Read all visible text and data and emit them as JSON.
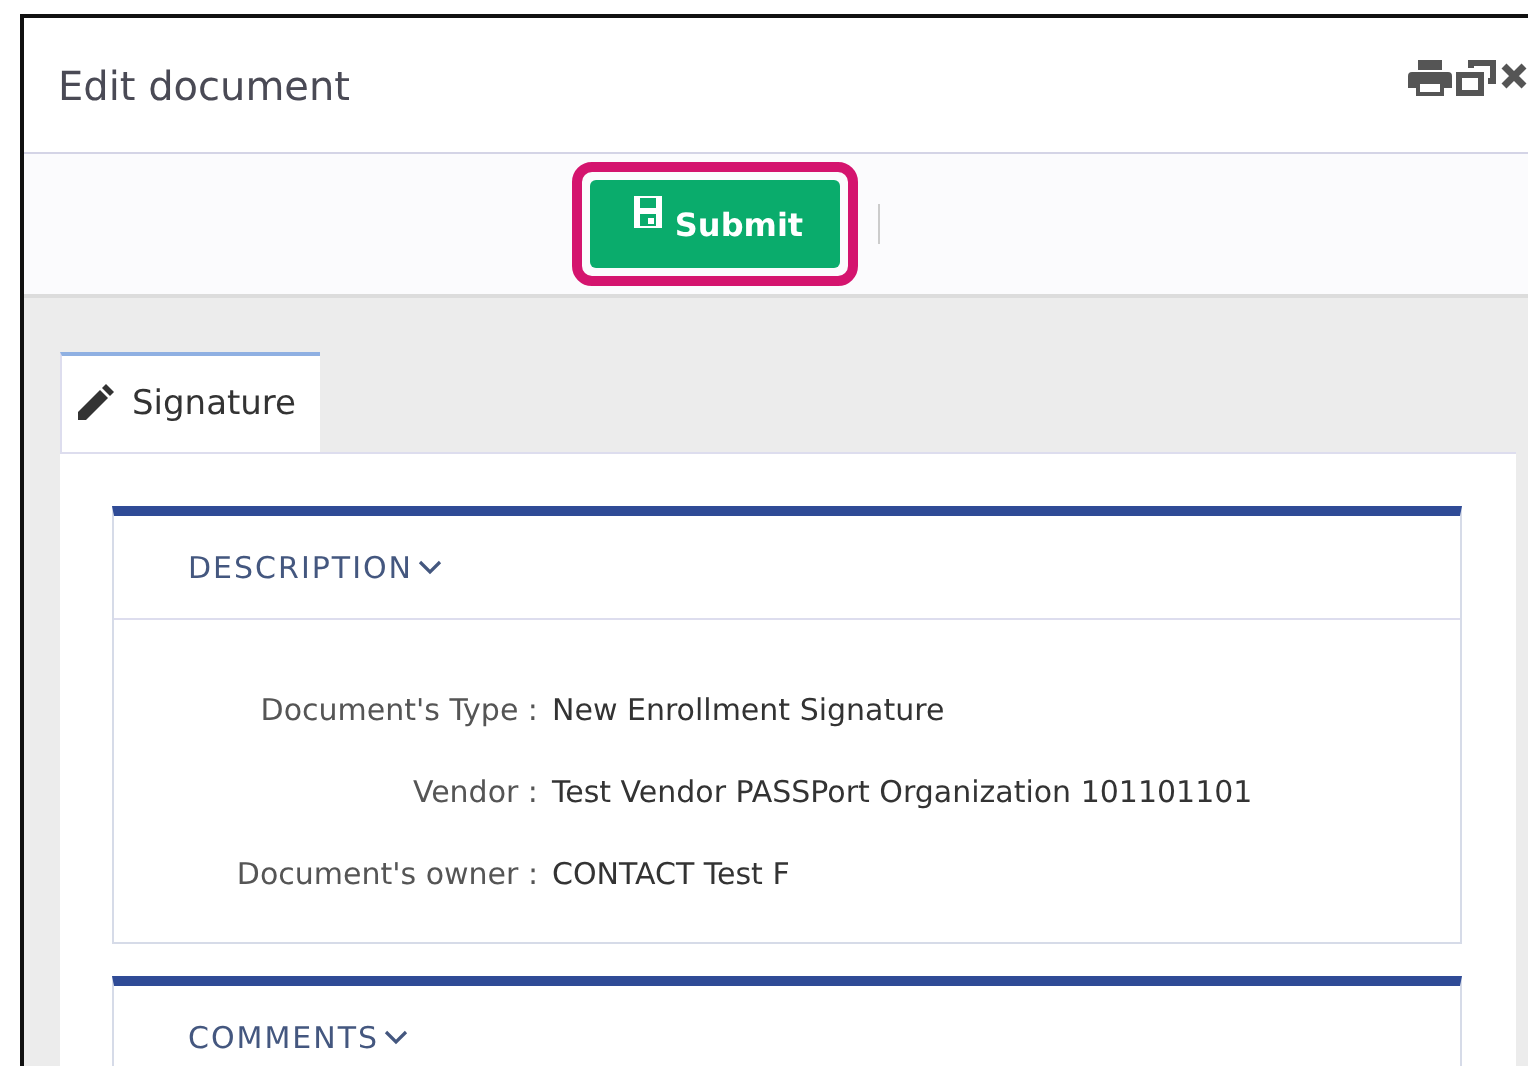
{
  "window": {
    "title": "Edit document"
  },
  "toolbar": {
    "submit_button": {
      "label": "Submit",
      "highlighted": true
    }
  },
  "tabs": [
    {
      "label": "Signature",
      "selected": true
    }
  ],
  "sections": [
    {
      "title": "DESCRIPTION",
      "fields": [
        {
          "label": "Document's Type :",
          "value": "New Enrollment Signature"
        },
        {
          "label": "Vendor :",
          "value": "Test Vendor PASSPort Organization 101101101"
        },
        {
          "label": "Document's owner :",
          "value": "CONTACT Test F"
        }
      ]
    },
    {
      "title": "COMMENTS"
    }
  ]
}
